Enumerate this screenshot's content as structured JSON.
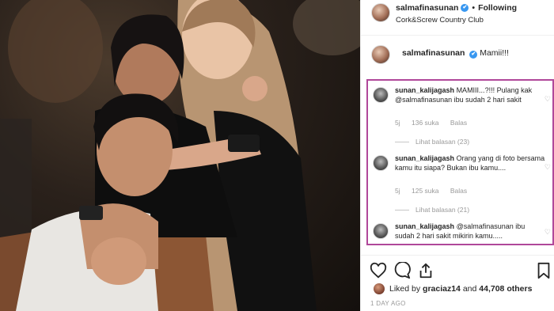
{
  "post": {
    "username": "salmafinasunan",
    "follow_state": "Following",
    "location": "Cork&Screw Country Club",
    "verified_mark": "✔",
    "separator": "•"
  },
  "caption": {
    "username": "salmafinasunan",
    "text": "Mamii!!!"
  },
  "comments": [
    {
      "username": "sunan_kalijagash",
      "text": "MAMIII...?!!! Pulang kak @salmafinasunan ibu sudah 2 hari sakit",
      "age": "5j",
      "likes": "136 suka",
      "reply_label": "Balas",
      "view_replies": "Lihat balasan (23)"
    },
    {
      "username": "sunan_kalijagash",
      "text": "Orang yang di foto bersama kamu itu siapa? Bukan ibu kamu....",
      "age": "5j",
      "likes": "125 suka",
      "reply_label": "Balas",
      "view_replies": "Lihat balasan (21)"
    },
    {
      "username": "sunan_kalijagash",
      "text": "@salmafinasunan ibu sudah 2 hari sakit mikirin kamu....."
    }
  ],
  "likes": {
    "prefix": "Liked by",
    "user": "graciaz14",
    "and": "and",
    "count": "44,708 others"
  },
  "timestamp": "1 DAY AGO",
  "icons": {
    "heart": "heart-icon",
    "comment": "comment-icon",
    "share": "share-icon",
    "bookmark": "bookmark-icon"
  },
  "colors": {
    "highlight_border": "#b0489a",
    "verified": "#3897f0",
    "muted": "#999999"
  }
}
